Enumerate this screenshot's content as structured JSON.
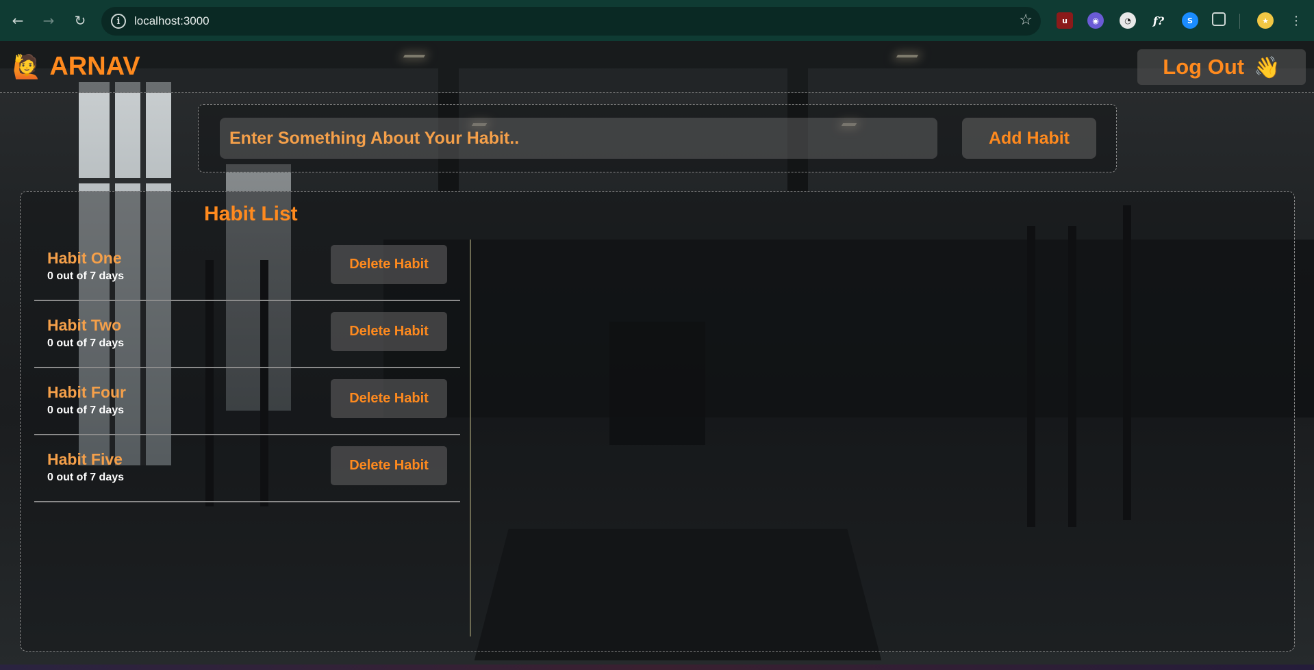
{
  "browser": {
    "url": "localhost:3000",
    "extensions": [
      "ublock-icon",
      "extension-purple-icon",
      "extension-clock-icon",
      "fonts-ninja-icon",
      "shazam-icon",
      "puzzle-icon"
    ],
    "profile": "profile-avatar"
  },
  "header": {
    "brand_emoji": "🙋",
    "brand_name": "ARNAV",
    "logout_label": "Log Out",
    "logout_emoji": "👋"
  },
  "add_habit": {
    "placeholder": "Enter Something About Your Habit..",
    "button_label": "Add Habit"
  },
  "habit_list": {
    "title": "Habit List",
    "delete_label": "Delete Habit",
    "items": [
      {
        "name": "Habit One",
        "progress": "0 out of 7 days"
      },
      {
        "name": "Habit Two",
        "progress": "0 out of 7 days"
      },
      {
        "name": "Habit Four",
        "progress": "0 out of 7 days"
      },
      {
        "name": "Habit Five",
        "progress": "0 out of 7 days"
      }
    ]
  },
  "colors": {
    "accent": "#ff8a1e",
    "chrome": "#0f3b33"
  }
}
